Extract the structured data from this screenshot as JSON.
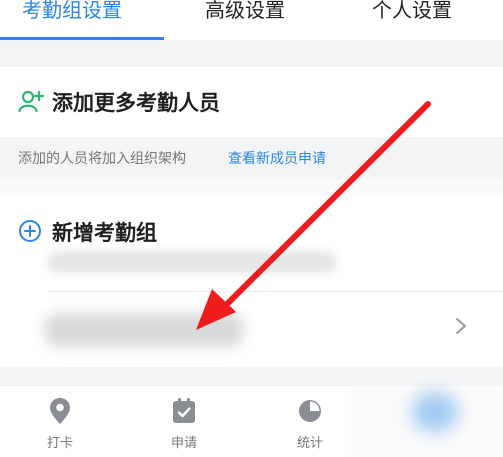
{
  "tabs": [
    {
      "label": "考勤组设置",
      "active": true
    },
    {
      "label": "高级设置",
      "active": false
    },
    {
      "label": "个人设置",
      "active": false
    }
  ],
  "add_member": {
    "label": "添加更多考勤人员",
    "icon": "add-user-icon"
  },
  "hint": {
    "text": "添加的人员将加入组织架构",
    "link": "查看新成员申请"
  },
  "group": {
    "label": "新增考勤组",
    "icon": "plus-circle-icon"
  },
  "bottom_nav": [
    {
      "label": "打卡",
      "icon": "location-pin-icon"
    },
    {
      "label": "申请",
      "icon": "calendar-check-icon"
    },
    {
      "label": "统计",
      "icon": "pie-chart-icon"
    }
  ],
  "colors": {
    "accent": "#2b86e8",
    "success": "#2bb673",
    "annotation": "#ee1c1c"
  }
}
